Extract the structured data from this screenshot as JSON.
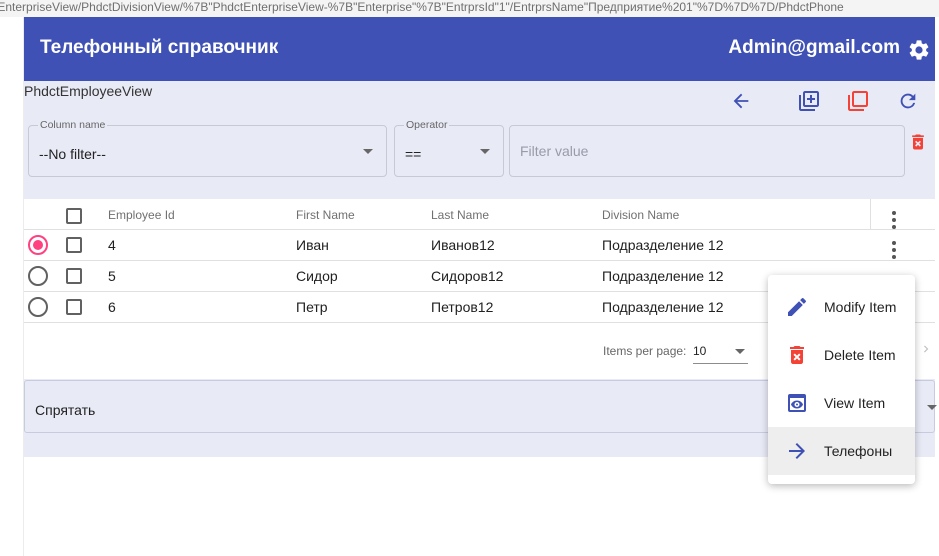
{
  "browser": {
    "url_text": "tEnterpriseView/PhdctDivisionView/%7B\"PhdctEnterpriseView-%7B\"Enterprise\"%7B\"EntrprsId\"1\"/EntrprsName\"Предприятие%201\"%7D%7D%7D/PhdctPhone"
  },
  "app": {
    "title": "Телефонный справочник",
    "user_email": "Admin@gmail.com",
    "colors": {
      "primary": "#3f51b5",
      "accent": "#ff4081",
      "warn": "#f44336",
      "panel_bg": "#e8eaf6"
    }
  },
  "view": {
    "name": "PhdctEmployeeView",
    "actions": [
      {
        "name": "back",
        "icon": "arrow-back-icon"
      },
      {
        "name": "add",
        "icon": "add-to-queue-icon"
      },
      {
        "name": "copy",
        "icon": "copy-icon"
      },
      {
        "name": "refresh",
        "icon": "refresh-icon"
      }
    ]
  },
  "filter": {
    "column_label": "Column name",
    "column_value": "--No filter--",
    "operator_label": "Operator",
    "operator_value": "==",
    "value_placeholder": "Filter value"
  },
  "table": {
    "columns": [
      "Employee Id",
      "First Name",
      "Last Name",
      "Division Name"
    ],
    "rows": [
      {
        "selected": true,
        "id": "4",
        "first": "Иван",
        "last": "Иванов12",
        "division": "Подразделение 12"
      },
      {
        "selected": false,
        "id": "5",
        "first": "Сидор",
        "last": "Сидоров12",
        "division": "Подразделение 12"
      },
      {
        "selected": false,
        "id": "6",
        "first": "Петр",
        "last": "Петров12",
        "division": "Подразделение 12"
      }
    ]
  },
  "paginator": {
    "items_per_page_label": "Items per page:",
    "items_per_page_value": "10"
  },
  "expansion": {
    "label": "Спрятать"
  },
  "context_menu": {
    "items": [
      {
        "label": "Modify Item",
        "icon": "edit-icon"
      },
      {
        "label": "Delete Item",
        "icon": "delete-icon"
      },
      {
        "label": "View Item",
        "icon": "view-icon"
      },
      {
        "label": "Телефоны",
        "icon": "arrow-forward-icon"
      }
    ]
  }
}
